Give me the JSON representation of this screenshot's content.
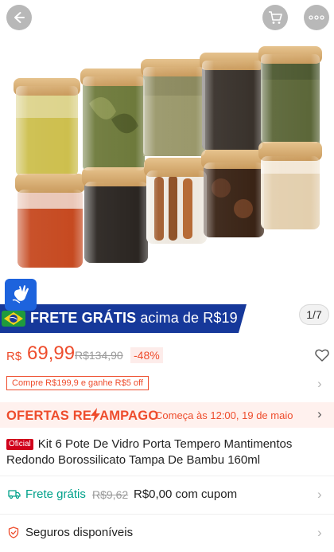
{
  "header": {
    "title": "Kit 6 Pote De Vidro Porta Tempero Mantimentos Redondo Borossilicato Tampa De Bambu 160ml",
    "icons": [
      "back-arrow-icon",
      "cart-icon",
      "more-icon"
    ]
  },
  "gallery": {
    "counter": "1/7",
    "banner": {
      "prefix": "FRETE GRÁTIS",
      "suffix": "acima de R$19"
    }
  },
  "price": {
    "currency": "R$",
    "current": "69,99",
    "original": "R$134,90",
    "discount": "-48%"
  },
  "coupon": {
    "label": "Compre R$199,9 e ganhe R$5 off"
  },
  "flash_sale": {
    "title_start": "OFERTAS RE",
    "title_end": "LÂMPAGO",
    "title_end_display": "AMPAGO",
    "time": "Começa às 12:00, 19 de maio"
  },
  "product": {
    "badge": "Oficial",
    "title": "Kit 6 Pote De Vidro Porta Tempero Mantimentos Redondo Borossilicato Tampa De Bambu 160ml"
  },
  "shipping": {
    "label": "Frete grátis",
    "old": "R$9,62",
    "new": "R$0,00 com cupom"
  },
  "insurance": {
    "label": "Seguros disponíveis"
  },
  "colors": {
    "accent": "#ee4d2d",
    "shipping_green": "#00a18a",
    "banner_blue": "#16389a",
    "access_blue": "#1d63dd"
  }
}
